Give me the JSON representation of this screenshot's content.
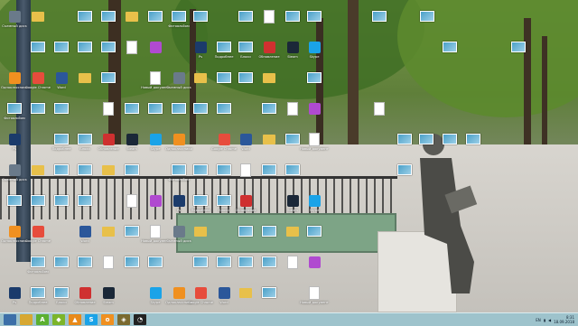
{
  "desktop": {
    "icons": [
      {
        "label": "Съемный диск",
        "type": "app",
        "color": "#6a7a8a"
      },
      {
        "label": "",
        "type": "folder"
      },
      {
        "label": "",
        "type": "img"
      },
      {
        "label": "",
        "type": "img"
      },
      {
        "label": "",
        "type": "folder"
      },
      {
        "label": "",
        "type": "img"
      },
      {
        "label": "Фотоальбом",
        "type": "img"
      },
      {
        "label": "",
        "type": "img"
      },
      {
        "label": "",
        "type": "img"
      },
      {
        "label": "",
        "type": "doc"
      },
      {
        "label": "",
        "type": "img"
      },
      {
        "label": "",
        "type": "img"
      },
      {
        "label": "",
        "type": "img"
      },
      {
        "label": "",
        "type": "img"
      },
      {
        "label": "",
        "type": "img"
      },
      {
        "label": "",
        "type": "img"
      },
      {
        "label": "",
        "type": "doc"
      },
      {
        "label": "",
        "type": "app",
        "color": "#b04ad0"
      },
      {
        "label": "Ps",
        "type": "app",
        "color": "#1b3b6b"
      },
      {
        "label": "Подробнее",
        "type": "img"
      },
      {
        "label": "Блоки",
        "type": "img"
      },
      {
        "label": "Обновление",
        "type": "app",
        "color": "#cf3030"
      },
      {
        "label": "Steam",
        "type": "app",
        "color": "#1b2838"
      },
      {
        "label": "Skype",
        "type": "app",
        "color": "#1aa3e8"
      },
      {
        "label": "Одноклассники",
        "type": "app",
        "color": "#f09020"
      },
      {
        "label": "Google Chrome",
        "type": "app",
        "color": "#e74c3c"
      },
      {
        "label": "Word",
        "type": "app",
        "color": "#2b579a"
      },
      {
        "label": "",
        "type": "folder"
      },
      {
        "label": "",
        "type": "img"
      },
      {
        "label": "Новый документ",
        "type": "doc"
      }
    ]
  },
  "taskbar": {
    "buttons": [
      {
        "name": "start-button",
        "glyph": "",
        "color": "#3c6fa8"
      },
      {
        "name": "explorer-button",
        "glyph": "",
        "color": "#d7a833"
      },
      {
        "name": "utorrent-button",
        "glyph": "A",
        "color": "#5cb030"
      },
      {
        "name": "app-green-button",
        "glyph": "◆",
        "color": "#7cb52a"
      },
      {
        "name": "app-orange-button",
        "glyph": "▲",
        "color": "#e88a1a"
      },
      {
        "name": "skype-button",
        "glyph": "S",
        "color": "#1aa3e8"
      },
      {
        "name": "odnoklassniki-button",
        "glyph": "o",
        "color": "#f09020"
      },
      {
        "name": "games-button",
        "glyph": "◈",
        "color": "#7a6a30"
      },
      {
        "name": "clock-app-button",
        "glyph": "◔",
        "color": "#222222"
      }
    ],
    "tray": {
      "language": "EN",
      "time": "8:31",
      "date": "18.09.2018"
    }
  }
}
